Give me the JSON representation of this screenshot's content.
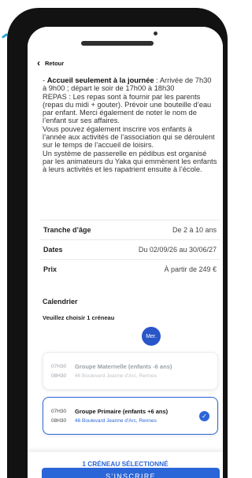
{
  "header": {
    "back_label": "Retour",
    "back_icon": "chevron-left-icon"
  },
  "description": {
    "lines_before_bold": "- ",
    "bold_title": "Accueil seulement à la journée",
    "after_bold": " : Arrivée de 7h30 à 9h00 ; départ le soir de 17h00 à 18h30",
    "meals": "REPAS : Les repas sont à fournir par les parents (repas du midi + gouter). Prévoir une bouteille d’eau par enfant. Merci également de noter le nom de l’enfant sur ses affaires.",
    "activities": "Vous pouvez également inscrire vos enfants à l’année aux activités de l’association qui se déroulent sur le temps de l’accueil de loisirs.",
    "pedibus": "Un système de passerelle en pédibus est organisé par les animateurs du Yaka qui emmènent les enfants à leurs activités et les rapatrient ensuite à l’école."
  },
  "info": [
    {
      "label": "Tranche d’âge",
      "value": "De 2 à 10 ans"
    },
    {
      "label": "Dates",
      "value": "Du 02/09/26 au 30/06/27"
    },
    {
      "label": "Prix",
      "value": "À partir de 249 €"
    }
  ],
  "calendar": {
    "title": "Calendrier",
    "subtitle": "Veuillez choisir 1 créneau",
    "day_badge": "Mer."
  },
  "slots": [
    {
      "start": "07H30",
      "end": "08H30",
      "group": "Groupe Maternelle (enfants -6 ans)",
      "address": "46 Boulevard Jeanne d'Arc, Rennes",
      "selected": false
    },
    {
      "start": "07H30",
      "end": "08H30",
      "group": "Groupe Primaire (enfants +6 ans)",
      "address": "46 Boulevard Jeanne d'Arc, Rennes",
      "selected": true
    }
  ],
  "footer": {
    "selected_count": "1 CRÉNEAU SÉLECTIONNÉ",
    "cta_label": "S'INSCRIRE"
  },
  "colors": {
    "accent": "#2b66d8",
    "badge": "#2956c8"
  }
}
